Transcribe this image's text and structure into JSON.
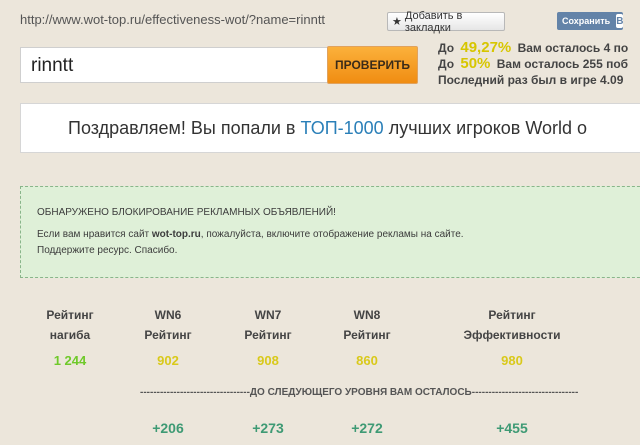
{
  "header": {
    "url": "http://www.wot-top.ru/effectiveness-wot/?name=rinntt",
    "bookmark_label": "Добавить в закладки",
    "vk_label": "Сохранить",
    "vk_letter": "В"
  },
  "search": {
    "value": "rinntt",
    "button_label": "ПРОВЕРИТЬ"
  },
  "progress": [
    {
      "prefix": "До",
      "percent": "49,27%",
      "text": "Вам осталось 4 по"
    },
    {
      "prefix": "До",
      "percent": "50%",
      "text": "Вам осталось 255 поб"
    },
    {
      "prefix": "",
      "percent": "",
      "text": "Последний раз был в игре 4.09"
    }
  ],
  "congrats": {
    "before": "Поздравляем! Вы попали в",
    "highlight": "ТОП-1000",
    "after": "лучших игроков World o"
  },
  "adblock": {
    "title": "ОБНАРУЖЕНО БЛОКИРОВАНИЕ РЕКЛАМНЫХ ОБЪЯВЛЕНИЙ!",
    "line1_before": "Если вам нравится сайт ",
    "line1_site": "wot-top.ru",
    "line1_after": ", пожалуйста, включите отображение рекламы на сайте.",
    "line2": "Поддержите ресурс. Спасибо."
  },
  "stats": [
    {
      "label1": "Рейтинг",
      "label2": "нагиба",
      "value": "1 244",
      "color": "#6fc92a"
    },
    {
      "label1": "WN6",
      "label2": "Рейтинг",
      "value": "902",
      "color": "#d9c91a"
    },
    {
      "label1": "WN7",
      "label2": "Рейтинг",
      "value": "908",
      "color": "#d9c91a"
    },
    {
      "label1": "WN8",
      "label2": "Рейтинг",
      "value": "860",
      "color": "#d9c91a"
    },
    {
      "label1": "Рейтинг",
      "label2": "Эффективности",
      "value": "980",
      "color": "#d9c91a"
    }
  ],
  "divider_text": "---------------------------------ДО СЛЕДУЮЩЕГО УРОВНЯ ВАМ ОСТАЛОСЬ--------------------------------",
  "gains": [
    "+206",
    "+273",
    "+272",
    "+455"
  ]
}
